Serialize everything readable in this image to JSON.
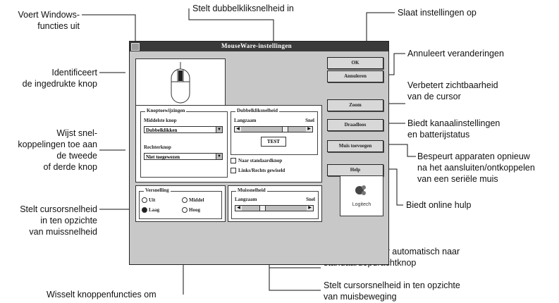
{
  "dialog": {
    "title": "MouseWare-instellingen",
    "buttons_group": "Knoptoewijzingen",
    "middle_label": "Middelste knop",
    "middle_value": "Dubbelklikken",
    "right_label": "Rechterknop",
    "right_value": "Niet toegewezen",
    "dbl_group": "Dubbelkliksnelheid",
    "slow": "Langzaam",
    "fast": "Snel",
    "test": "TEST",
    "chk_default": "Naar standaardknop",
    "chk_swap": "Links/Rechts gewiseld",
    "accel_group": "Versnelling",
    "off": "Uit",
    "low": "Laag",
    "medium": "Middel",
    "high": "Hoog",
    "speed_group": "Muissnelheid",
    "ok": "OK",
    "cancel": "Annuleren",
    "zoom": "Zoom",
    "wireless": "Draadloos",
    "rescan": "Muis toevoegen",
    "help": "Help",
    "logo": "Logitech",
    "accel_selected": "Laag",
    "dbl_thumb": 0.7,
    "speed_thumb": 0.3
  },
  "callouts": {
    "windows": "Voert Windows-\nfuncties uit",
    "identify": "Identificeert\nde ingedrukte knop",
    "shortcuts": "Wijst snel-\nkoppelingen toe aan\nde tweede\nof derde knop",
    "cursor_speed": "Stelt cursorsnelheid\nin ten opzichte\nvan muissnelheid",
    "swap": "Wisselt knoppenfuncties om",
    "dblclick": "Stelt dubbelkliksnelheid in",
    "save": "Slaat instellingen op",
    "cancel": "Annuleert veranderingen",
    "visibility": "Verbetert zichtbaarheid\nvan de cursor",
    "channel": "Biedt kanaalinstellingen\nen batterijstatus",
    "rescan": "Bespeurt apparaten opnieuw\nna  het aansluiten/ontkoppelen\nvan  een seriële muis",
    "help": "Biedt online hulp",
    "autojump": "Verplaatst cursor automatisch naar\nstandaardopdrachtknop",
    "movement": "Stelt cursorsnelheid in ten opzichte\nvan muisbeweging"
  }
}
